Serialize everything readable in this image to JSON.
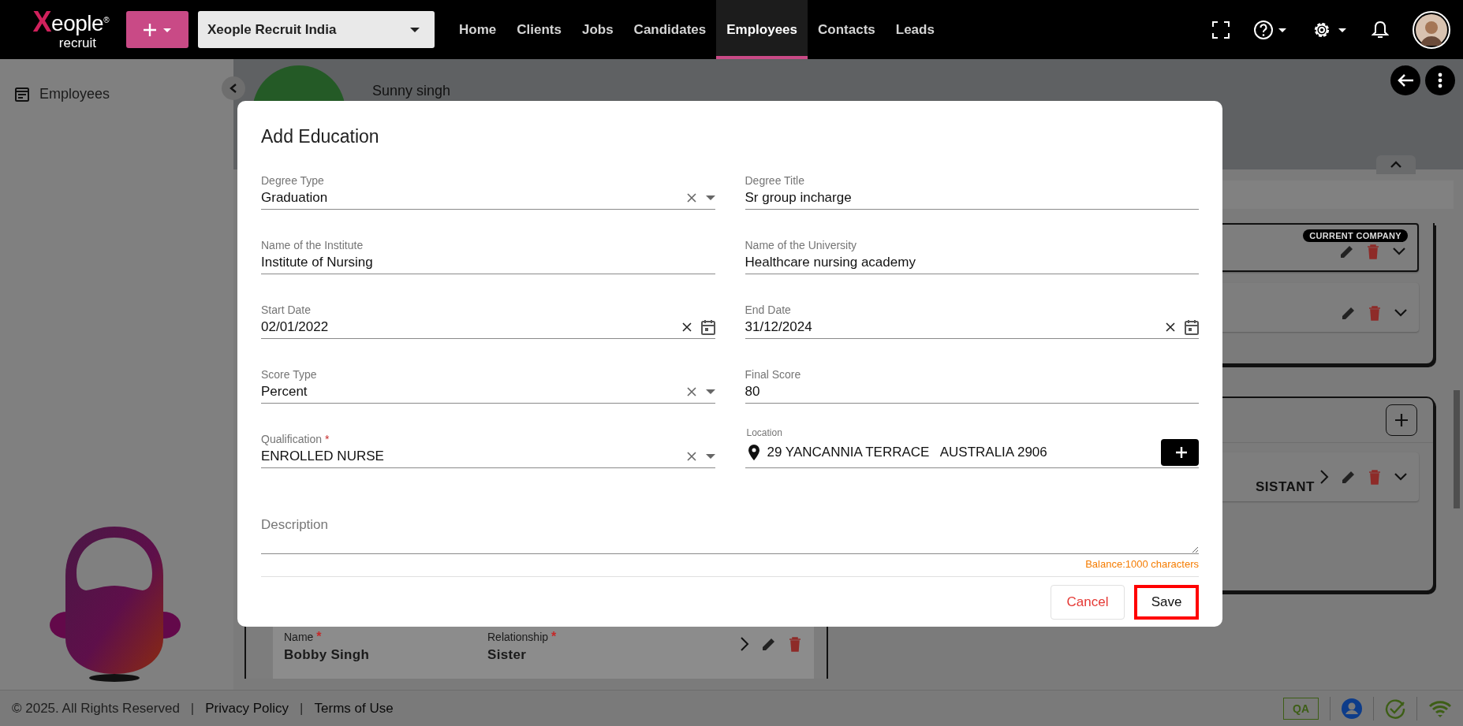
{
  "top_bar": {
    "logo": {
      "name": "Xeople$^{®}$",
      "tagline": "recruit"
    },
    "company_select": {
      "value": "Xeople Recruit India"
    },
    "nav": [
      {
        "label": "Home",
        "selected": false
      },
      {
        "label": "Clients",
        "selected": false
      },
      {
        "label": "Jobs",
        "selected": false
      },
      {
        "label": "Candidates",
        "selected": false
      },
      {
        "label": "Employees",
        "selected": true
      },
      {
        "label": "Contacts",
        "selected": false
      },
      {
        "label": "Leads",
        "selected": false
      }
    ]
  },
  "sidebar": {
    "items": [
      {
        "label": "Employees"
      }
    ]
  },
  "profile": {
    "name": "Sunny singh"
  },
  "experience": {
    "badge": "CURRENT COMPANY",
    "partial_title": "SISTANT"
  },
  "contact": {
    "fields": [
      {
        "label": "Name",
        "required_mark": "*",
        "value": "Bobby Singh"
      },
      {
        "label": "Relationship",
        "required_mark": "*",
        "value": "Sister"
      }
    ]
  },
  "dialog": {
    "title": "Add Education",
    "fields": [
      {
        "kind": "select",
        "label": "Degree Type",
        "value": "Graduation"
      },
      {
        "kind": "text",
        "label": "Degree Title",
        "value": "Sr group incharge"
      },
      {
        "kind": "text",
        "label": "Name of the Institute",
        "value": "Institute of Nursing"
      },
      {
        "kind": "text",
        "label": "Name of the University",
        "value": "Healthcare nursing academy"
      },
      {
        "kind": "date",
        "label": "Start Date",
        "value": "02/01/2022"
      },
      {
        "kind": "date",
        "label": "End Date",
        "value": "31/12/2024"
      },
      {
        "kind": "select",
        "label": "Score Type",
        "value": "Percent"
      },
      {
        "kind": "text",
        "label": "Final Score",
        "value": "80"
      },
      {
        "kind": "select",
        "label": "Qualification",
        "value": "ENROLLED NURSE",
        "required_mark": "*"
      },
      {
        "kind": "location",
        "label": "Location",
        "value": "29 YANCANNIA TERRACE   AUSTRALIA 2906"
      }
    ],
    "description": {
      "placeholder": "Description"
    },
    "balance": "Balance:1000 characters",
    "buttons": [
      {
        "kind": "cancel",
        "label": "Cancel",
        "highlighted": false
      },
      {
        "kind": "save",
        "label": "Save",
        "highlighted": true
      }
    ]
  },
  "footer": {
    "items": [
      {
        "kind": "text",
        "label": "© 2025. All Rights Reserved"
      },
      {
        "kind": "separator",
        "label": "|"
      },
      {
        "kind": "link",
        "label": "Privacy Policy"
      },
      {
        "kind": "separator",
        "label": "|"
      },
      {
        "kind": "link",
        "label": "Terms of Use"
      }
    ],
    "env": "QA"
  }
}
